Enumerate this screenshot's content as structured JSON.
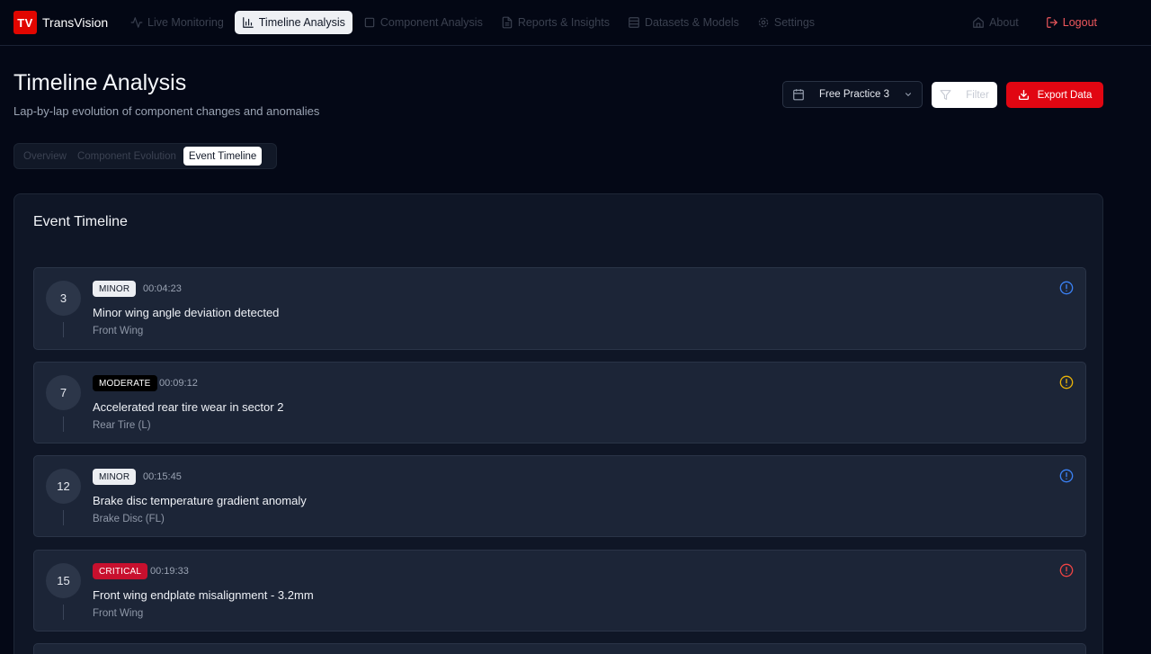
{
  "app": {
    "logo": "TV",
    "name": "TransVision"
  },
  "nav": {
    "items": [
      {
        "label": "Live Monitoring",
        "icon": "activity-icon",
        "active": false
      },
      {
        "label": "Timeline Analysis",
        "icon": "bar-chart-icon",
        "active": true
      },
      {
        "label": "Component Analysis",
        "icon": "box-icon",
        "active": false
      },
      {
        "label": "Reports & Insights",
        "icon": "file-text-icon",
        "active": false
      },
      {
        "label": "Datasets & Models",
        "icon": "database-icon",
        "active": false
      },
      {
        "label": "Settings",
        "icon": "gear-icon",
        "active": false
      }
    ],
    "about": "About",
    "logout": "Logout"
  },
  "header": {
    "title": "Timeline Analysis",
    "subtitle": "Lap-by-lap evolution of component changes and anomalies",
    "session_select": "Free Practice 3",
    "filter": "Filter",
    "export": "Export Data"
  },
  "tabs": [
    {
      "label": "Overview",
      "active": false
    },
    {
      "label": "Component Evolution",
      "active": false
    },
    {
      "label": "Event Timeline",
      "active": true
    }
  ],
  "event_timeline": {
    "title": "Event Timeline",
    "events": [
      {
        "lap": "3",
        "severity": "MINOR",
        "time": "00:04:23",
        "description": "Minor wing angle deviation detected",
        "component": "Front Wing",
        "icon_color": "#3b82f6"
      },
      {
        "lap": "7",
        "severity": "MODERATE",
        "time": "00:09:12",
        "description": "Accelerated rear tire wear in sector 2",
        "component": "Rear Tire (L)",
        "icon_color": "#eab308"
      },
      {
        "lap": "12",
        "severity": "MINOR",
        "time": "00:15:45",
        "description": "Brake disc temperature gradient anomaly",
        "component": "Brake Disc (FL)",
        "icon_color": "#3b82f6"
      },
      {
        "lap": "15",
        "severity": "CRITICAL",
        "time": "00:19:33",
        "description": "Front wing endplate misalignment - 3.2mm",
        "component": "Front Wing",
        "icon_color": "#ef4444"
      }
    ]
  },
  "colors": {
    "brand": "#e10600",
    "background": "#040816",
    "card": "#0f1626",
    "event_card": "#1c2537",
    "minor": "#3b82f6",
    "moderate": "#eab308",
    "critical": "#ef4444"
  }
}
